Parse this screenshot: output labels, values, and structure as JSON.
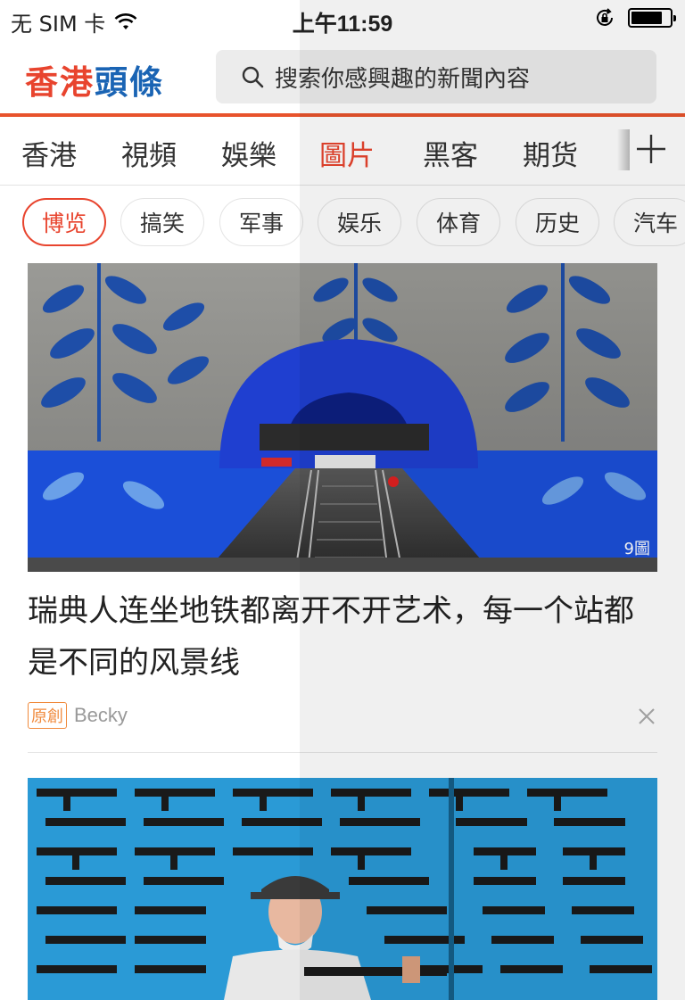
{
  "status": {
    "carrier": "无 SIM 卡",
    "time": "上午11:59"
  },
  "header": {
    "logo_part1": "香港",
    "logo_part2": "頭條",
    "search_placeholder": "搜索你感興趣的新聞內容"
  },
  "channels": [
    "香港",
    "視頻",
    "娛樂",
    "圖片",
    "黑客",
    "期货"
  ],
  "active_channel": "圖片",
  "chips": [
    "博览",
    "搞笑",
    "军事",
    "娱乐",
    "体育",
    "历史",
    "汽车"
  ],
  "active_chip": "博览",
  "articles": [
    {
      "title": "瑞典人连坐地铁都离开不开艺术，每一个站都是不同的风景线",
      "image_count": "9圖",
      "badge": "原創",
      "author": "Becky"
    }
  ],
  "colors": {
    "accent": "#e8442e",
    "logo_blue": "#1a64b4",
    "badge": "#f08a3c"
  },
  "icons": [
    "wifi-icon",
    "orientation-lock-icon",
    "battery-icon",
    "search-icon",
    "add-channel-icon",
    "close-icon"
  ]
}
